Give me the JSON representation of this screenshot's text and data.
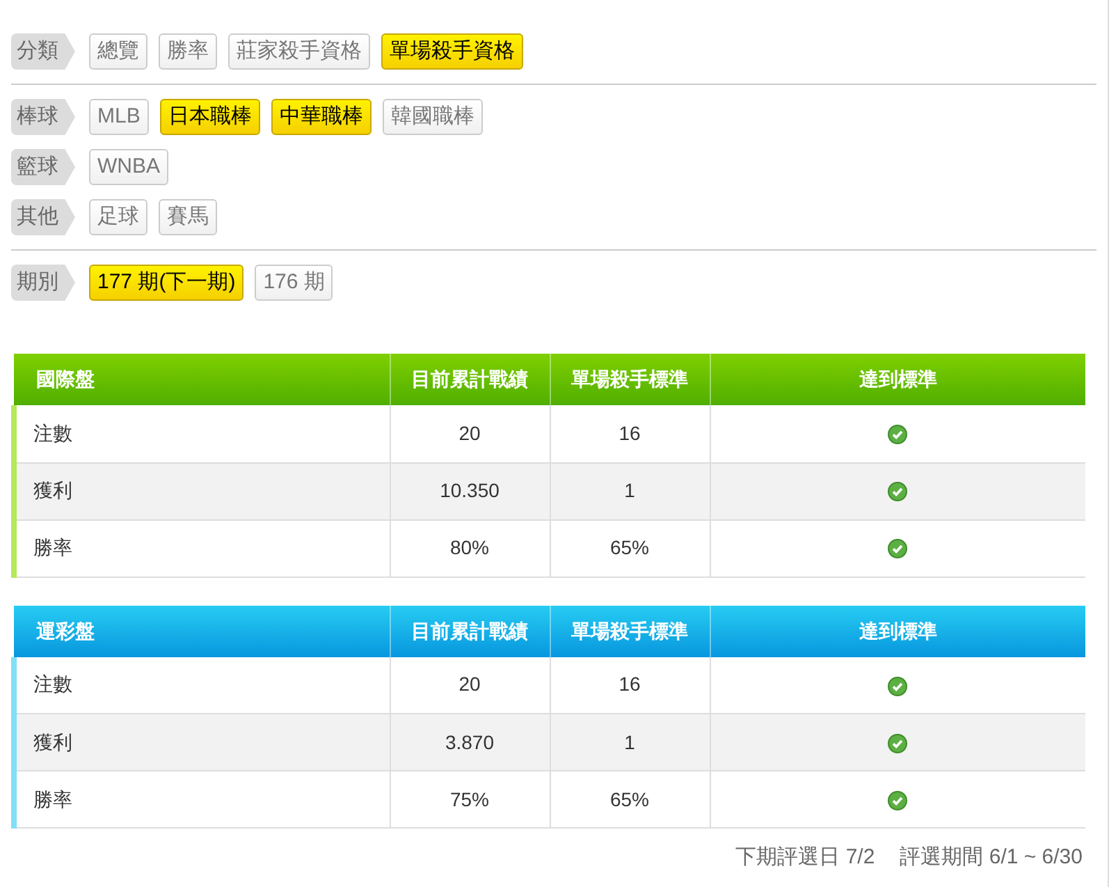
{
  "filter_groups": [
    [
      {
        "label": "分類",
        "options": [
          {
            "text": "總覽",
            "selected": false
          },
          {
            "text": "勝率",
            "selected": false
          },
          {
            "text": "莊家殺手資格",
            "selected": false
          },
          {
            "text": "單場殺手資格",
            "selected": true
          }
        ]
      }
    ],
    [
      {
        "label": "棒球",
        "options": [
          {
            "text": "MLB",
            "selected": false
          },
          {
            "text": "日本職棒",
            "selected": true
          },
          {
            "text": "中華職棒",
            "selected": true
          },
          {
            "text": "韓國職棒",
            "selected": false
          }
        ]
      },
      {
        "label": "籃球",
        "options": [
          {
            "text": "WNBA",
            "selected": false
          }
        ]
      },
      {
        "label": "其他",
        "options": [
          {
            "text": "足球",
            "selected": false
          },
          {
            "text": "賽馬",
            "selected": false
          }
        ]
      }
    ],
    [
      {
        "label": "期別",
        "options": [
          {
            "text": "177 期(下一期)",
            "selected": true
          },
          {
            "text": "176 期",
            "selected": false
          }
        ]
      }
    ]
  ],
  "tables": [
    {
      "kind": "green",
      "columns": [
        "國際盤",
        "目前累計戰績",
        "單場殺手標準",
        "達到標準"
      ],
      "rows": [
        {
          "name": "注數",
          "current": "20",
          "standard": "16",
          "met": true
        },
        {
          "name": "獲利",
          "current": "10.350",
          "standard": "1",
          "met": true
        },
        {
          "name": "勝率",
          "current": "80%",
          "standard": "65%",
          "met": true
        }
      ]
    },
    {
      "kind": "blue",
      "columns": [
        "運彩盤",
        "目前累計戰績",
        "單場殺手標準",
        "達到標準"
      ],
      "rows": [
        {
          "name": "注數",
          "current": "20",
          "standard": "16",
          "met": true
        },
        {
          "name": "獲利",
          "current": "3.870",
          "standard": "1",
          "met": true
        },
        {
          "name": "勝率",
          "current": "75%",
          "standard": "65%",
          "met": true
        }
      ]
    }
  ],
  "footer": {
    "next_date": "下期評選日 7/2",
    "period": "評選期間 6/1 ~ 6/30"
  }
}
